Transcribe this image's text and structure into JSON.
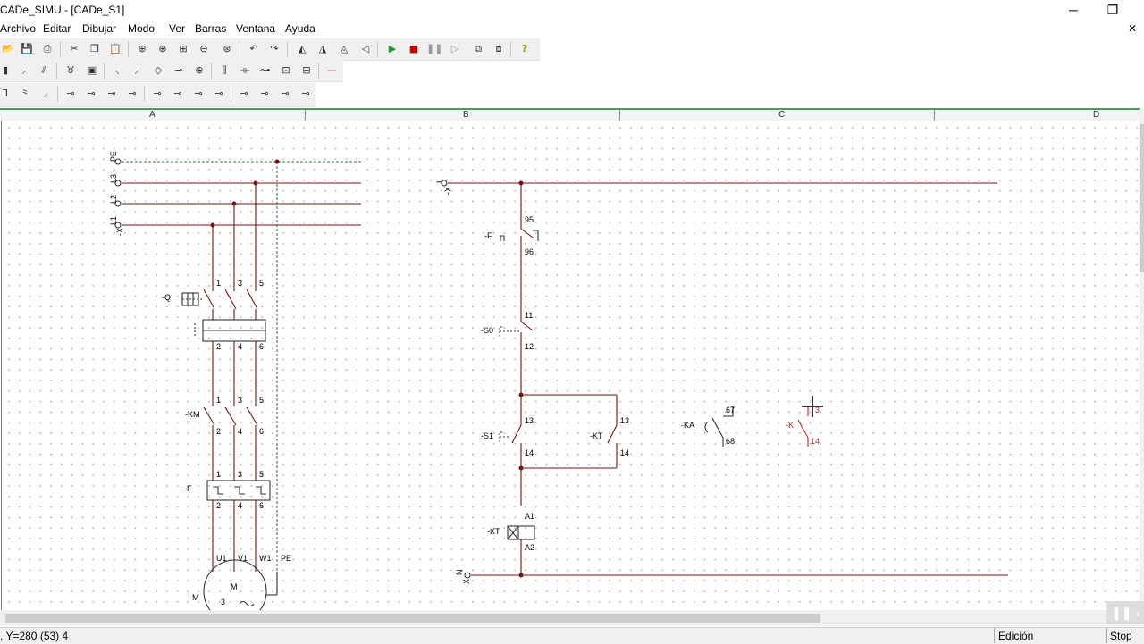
{
  "window": {
    "title": "CADe_SIMU - [CADe_S1]",
    "min": "─",
    "restore": "❐",
    "close": "✕",
    "mdi_close": "✕"
  },
  "menu": [
    "Archivo",
    "Editar",
    "Dibujar",
    "Modo",
    "Ver",
    "Barras",
    "Ventana",
    "Ayuda"
  ],
  "icons": {
    "row1": [
      "open-icon",
      "save-icon",
      "print-icon",
      "cut-icon",
      "copy-icon",
      "paste-icon",
      "zoom-fit-icon",
      "zoom-in-icon",
      "zoom-window-icon",
      "zoom-out-icon",
      "zoom-pan-icon",
      "undo-icon",
      "redo-icon",
      "rotate-icon",
      "rotate-back-icon",
      "mirror-icon",
      "mirror-v-icon",
      "play-icon",
      "stop-icon",
      "pause-icon",
      "step-icon",
      "view-icon",
      "options-icon",
      "help-icon"
    ],
    "row2": [
      "power-source-icon",
      "fuse-icon",
      "disconnector-icon",
      "motor-icon",
      "battery-icon",
      "switch-icon",
      "breaker-icon",
      "lamp-icon",
      "contactor-icon",
      "relay-icon",
      "meter-icon",
      "transformer-icon",
      "terminal-icon",
      "connector-icon",
      "wire-icon"
    ],
    "row3": [
      "pushbutton-no-icon",
      "pushbutton-nc-icon",
      "limit-switch-icon",
      "contact-no-icon",
      "contact-nc-icon",
      "timer-on-icon",
      "timer-off-icon",
      "timer-nc-icon",
      "sensor-icon",
      "sensor-nc-icon",
      "level-icon",
      "level-nc-icon",
      "pressure-icon",
      "pressure-nc-icon",
      "temp-icon",
      "temp-nc-icon"
    ]
  },
  "ruler": {
    "columns": [
      "A",
      "B",
      "C",
      "D"
    ]
  },
  "diagram": {
    "power": {
      "lines": [
        "PE",
        "L3",
        "L2",
        "L1"
      ],
      "terminal_block": "-X",
      "q_label": "-Q",
      "km_label": "-KM",
      "f_label": "-F",
      "m_label": "-M",
      "motor_text": "M",
      "motor_phases": "3",
      "motor_ac": "~",
      "top_terms": [
        "1",
        "3",
        "5"
      ],
      "bottom_terms": [
        "2",
        "4",
        "6"
      ],
      "motor_terms": [
        "U1",
        "V1",
        "W1",
        "PE"
      ]
    },
    "control": {
      "l_label": "L",
      "n_label": "N",
      "x_label": "-X",
      "f_label": "-F",
      "f_terms": [
        "95",
        "96"
      ],
      "s0_label": "-S0",
      "s0_terms": [
        "11",
        "12"
      ],
      "s1_label": "-S1",
      "s1_terms": [
        "13",
        "14"
      ],
      "kt_contact_label": "-KT",
      "kt_contact_terms": [
        "13",
        "14"
      ],
      "kt_coil_label": "-KT",
      "kt_coil_terms": [
        "A1",
        "A2"
      ],
      "ka_label": "-KA",
      "ka_terms": [
        "67",
        "68"
      ],
      "k_label": "-K",
      "k_terms": [
        "3",
        "14"
      ]
    }
  },
  "status": {
    "coords": ", Y=280 (53) 4",
    "mode": "Edición",
    "sim": "Stop"
  }
}
